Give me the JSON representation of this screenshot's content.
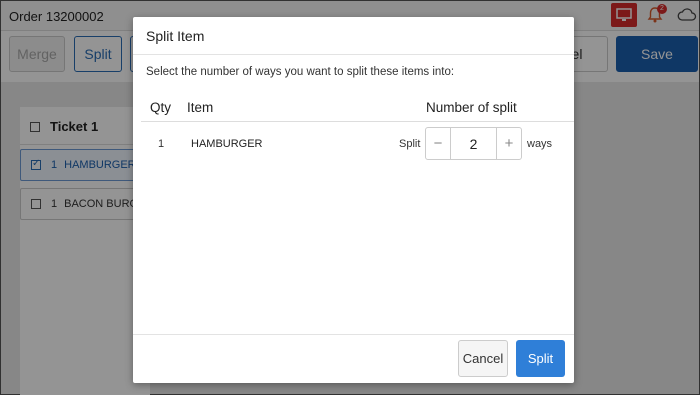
{
  "app": {
    "order_title": "Order 13200002",
    "notification_count": "2",
    "icons": {
      "monitor": "monitor-icon",
      "bell": "bell-icon",
      "cloud": "cloud-icon"
    },
    "colors": {
      "accent": "#2f7fd8",
      "primary_dark": "#1b5fae",
      "alert": "#d62b2b"
    }
  },
  "toolbar": {
    "merge_label": "Merge",
    "split_label": "Split",
    "cancel_label": "el",
    "save_label": "Save"
  },
  "ticket": {
    "title": "Ticket 1",
    "items": [
      {
        "qty": "1",
        "name": "HAMBURGER",
        "checked": true
      },
      {
        "qty": "1",
        "name": "BACON BURG",
        "checked": false
      }
    ]
  },
  "modal": {
    "title": "Split Item",
    "instruction": "Select the number of ways you want to split these items into:",
    "columns": {
      "qty": "Qty",
      "item": "Item",
      "split": "Number of split"
    },
    "rows": [
      {
        "qty": "1",
        "item": "HAMBURGER",
        "split_label": "Split",
        "split_value": "2",
        "ways_label": "ways",
        "minus_symbol": "−",
        "plus_symbol": "+"
      }
    ],
    "cancel_label": "Cancel",
    "split_label": "Split"
  }
}
